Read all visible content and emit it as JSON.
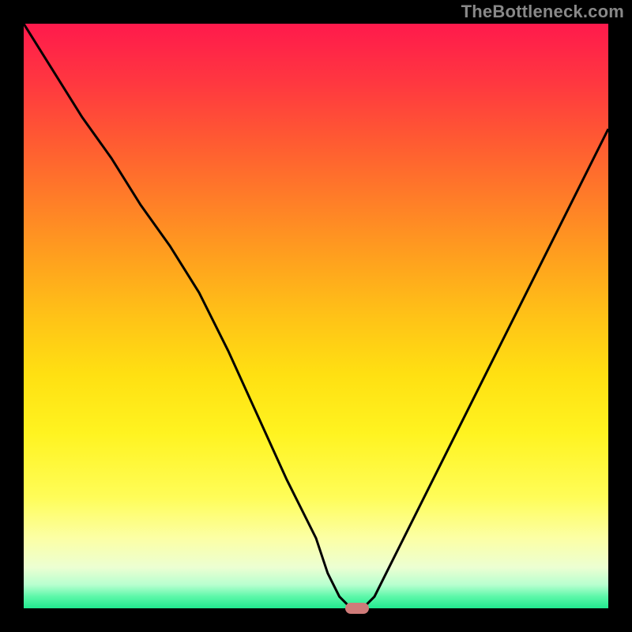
{
  "watermark": "TheBottleneck.com",
  "colors": {
    "frame": "#000000",
    "watermark": "#888888",
    "curve": "#000000",
    "marker": "#cf7b79",
    "gradient_stops": [
      {
        "offset": "0%",
        "color": "#ff1a4c"
      },
      {
        "offset": "10%",
        "color": "#ff3740"
      },
      {
        "offset": "20%",
        "color": "#ff5a32"
      },
      {
        "offset": "30%",
        "color": "#ff7d28"
      },
      {
        "offset": "40%",
        "color": "#ffa01e"
      },
      {
        "offset": "50%",
        "color": "#ffc217"
      },
      {
        "offset": "60%",
        "color": "#ffe012"
      },
      {
        "offset": "70%",
        "color": "#fff320"
      },
      {
        "offset": "81%",
        "color": "#fffd58"
      },
      {
        "offset": "88%",
        "color": "#fcffa5"
      },
      {
        "offset": "93%",
        "color": "#ecffd2"
      },
      {
        "offset": "96%",
        "color": "#b7ffcf"
      },
      {
        "offset": "98%",
        "color": "#5cf7a9"
      },
      {
        "offset": "100%",
        "color": "#21e98f"
      }
    ]
  },
  "chart_data": {
    "type": "line",
    "title": "",
    "xlabel": "",
    "ylabel": "",
    "xlim": [
      0,
      100
    ],
    "ylim": [
      0,
      100
    ],
    "x": [
      0,
      5,
      10,
      15,
      20,
      25,
      30,
      35,
      40,
      45,
      50,
      52,
      54,
      56,
      58,
      60,
      62,
      65,
      70,
      75,
      80,
      85,
      90,
      95,
      100
    ],
    "values": [
      100,
      92,
      84,
      77,
      69,
      62,
      54,
      44,
      33,
      22,
      12,
      6,
      2,
      0,
      0,
      2,
      6,
      12,
      22,
      32,
      42,
      52,
      62,
      72,
      82
    ],
    "marker": {
      "x": 57,
      "y": 0
    }
  }
}
